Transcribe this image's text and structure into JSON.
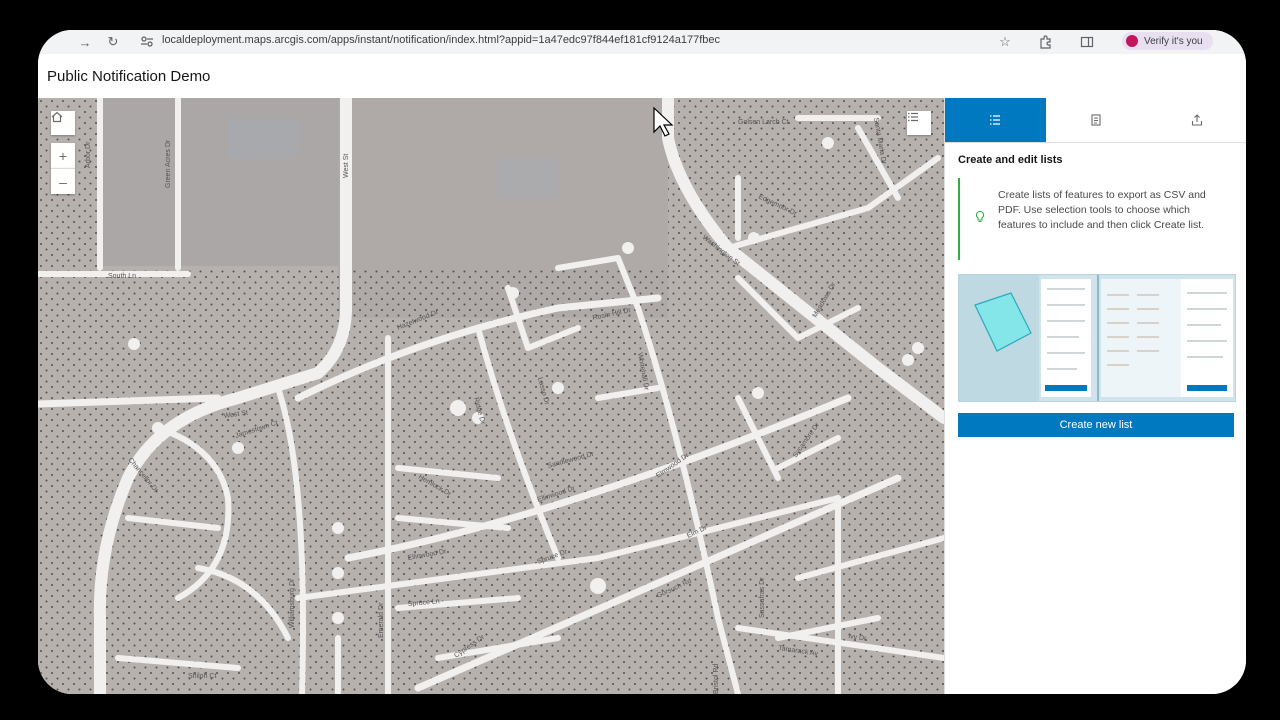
{
  "browser": {
    "url": "localdeployment.maps.arcgis.com/apps/instant/notification/index.html?appid=1a47edc97f844ef181cf9124a177fbec",
    "verify_label": "Verify it's you",
    "icons": [
      "forward-icon",
      "reload-icon",
      "site-info-icon",
      "star-icon",
      "extensions-icon",
      "side-panel-icon"
    ]
  },
  "app": {
    "title": "Public Notification Demo"
  },
  "map": {
    "controls": {
      "home": "home-icon",
      "zoom_in": "+",
      "zoom_out": "–",
      "legend": "list-icon"
    },
    "street_labels": [
      "West St",
      "South Ln",
      "Arbor Dr",
      "Green Acres Dr",
      "Golsen Larch Ct",
      "Santa Maria Dr",
      "Edgemoor Dr",
      "Washington St",
      "Meadows Dr",
      "Hazelwood Dr",
      "Rosin Hill Dr",
      "Ridge Dr",
      "Lasso Dr",
      "Whitehall Dr",
      "Ruth St",
      "Fire Dr",
      "Sandlewood Dr",
      "Elmwood Dr",
      "Ellis Dr",
      "Birch Dr",
      "Oaks Dr",
      "Sycamore Dr",
      "Colonial Dr",
      "Chancellor Dr",
      "West St",
      "Jamestown Ct",
      "Grant Ln",
      "Ellis Ln",
      "Ellinwood Dr",
      "Spruce Dr",
      "Elm Dr",
      "Burroak Dr",
      "Wyckham Ct",
      "Cypress Dr",
      "Spruce Ln",
      "Williamsburg Dr",
      "Emerald Dr",
      "Gorsuch Rd",
      "Sassafras Dr",
      "Bristol Rd",
      "Tamarack Av",
      "Hemlock Dr",
      "Shiloh Ct",
      "Ivy Dr",
      "Park Rd"
    ]
  },
  "panel": {
    "tabs": [
      {
        "name": "list-tab",
        "icon": "list-icon",
        "active": true
      },
      {
        "name": "report-tab",
        "icon": "report-icon",
        "active": false
      },
      {
        "name": "export-tab",
        "icon": "export-icon",
        "active": false
      }
    ],
    "title": "Create and edit lists",
    "notice": "Create lists of features to export as CSV and PDF. Use selection tools to choose which features to include and then click Create list.",
    "create_button": "Create new list",
    "colors": {
      "accent": "#0079c1",
      "notice": "#35ac46"
    }
  }
}
